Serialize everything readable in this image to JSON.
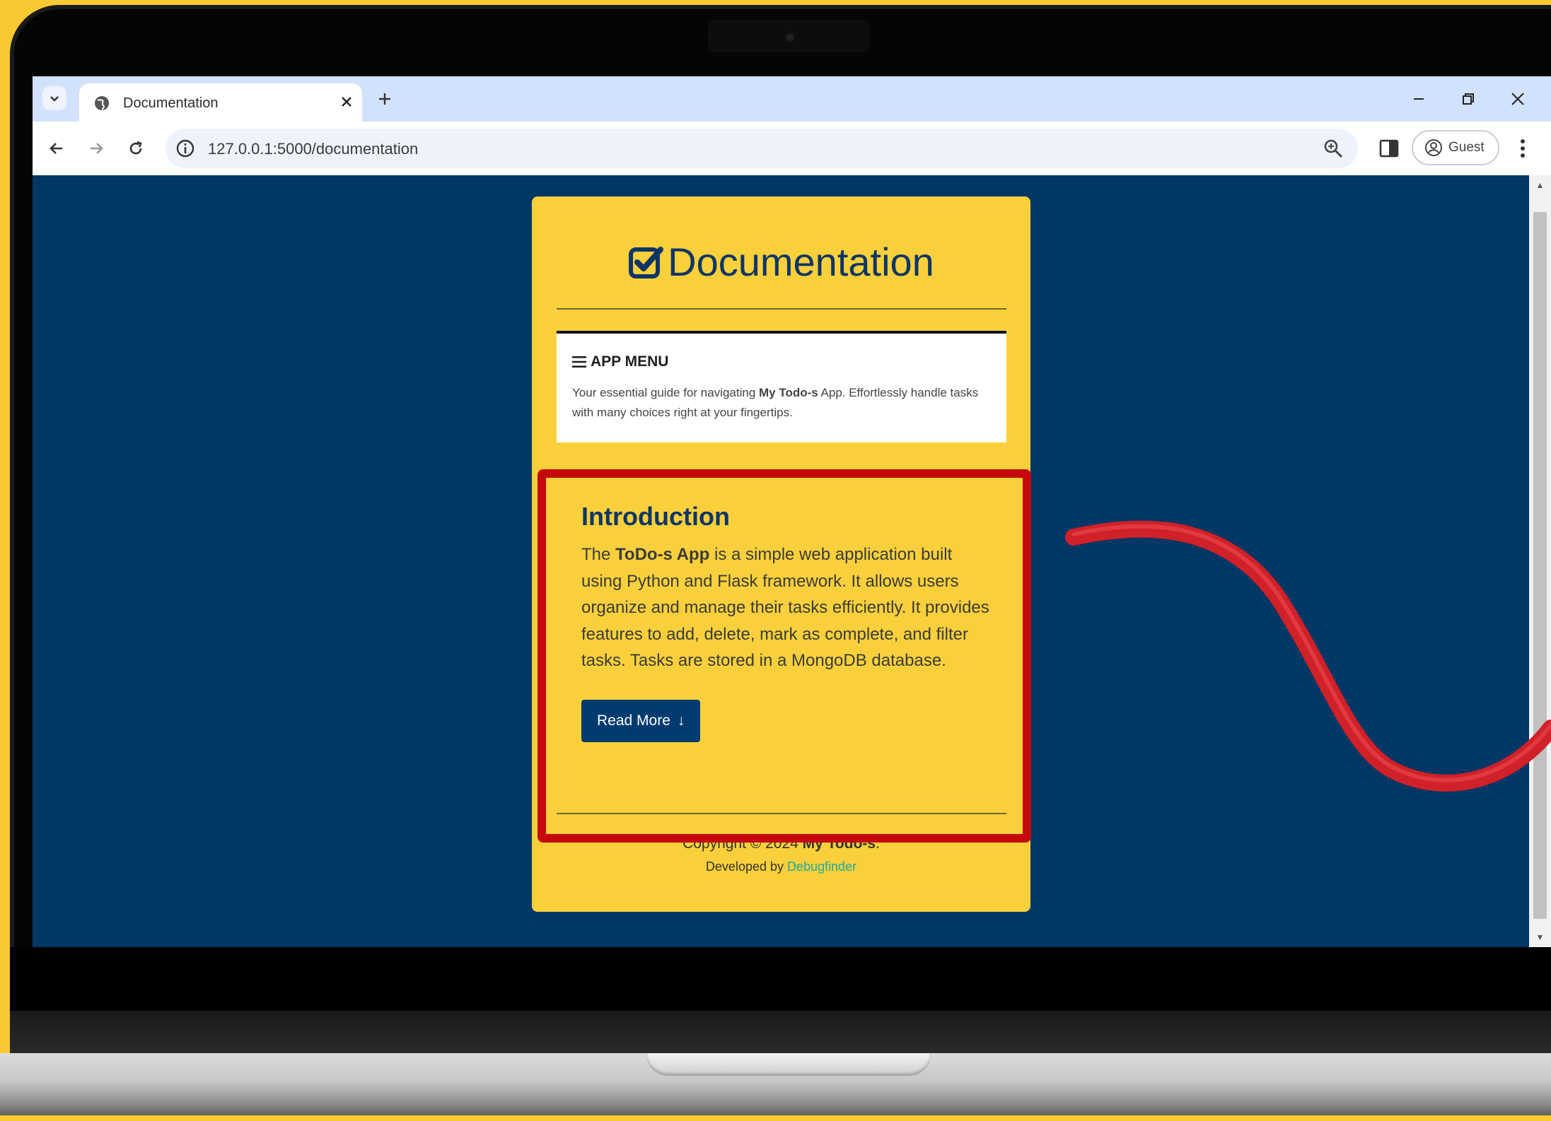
{
  "browser": {
    "tab_title": "Documentation",
    "url": "127.0.0.1:5000/documentation",
    "profile_label": "Guest",
    "icons": [
      "chevron-down-icon",
      "globe-icon",
      "close-icon",
      "plus-icon",
      "minimize-icon",
      "restore-icon",
      "window-close-icon",
      "back-icon",
      "forward-icon",
      "reload-icon",
      "info-icon",
      "zoom-icon",
      "side-panel-icon",
      "profile-icon",
      "kebab-menu-icon"
    ]
  },
  "page": {
    "title": "Documentation",
    "title_icon": "check-square-icon",
    "menu": {
      "heading": "APP MENU",
      "heading_icon": "bars-icon",
      "desc_before": "Your essential guide for navigating ",
      "desc_bold": "My Todo-s",
      "desc_after": " App. Effortlessly handle tasks with many choices right at your fingertips."
    },
    "intro": {
      "title": "Introduction",
      "text_before": "The ",
      "text_bold": "ToDo-s App",
      "text_after": " is a simple web application built using Python and Flask framework. It allows users organize and manage their tasks efficiently. It provides features to add, delete, mark as complete, and filter tasks. Tasks are stored in a MongoDB database.",
      "button_label": "Read More",
      "button_icon": "↓"
    },
    "footer": {
      "copyright_before": "Copyright © 2024 ",
      "copyright_bold": "My Todo-s",
      "copyright_after": ".",
      "developed_before": "Developed by ",
      "developed_link": "Debugfinder"
    }
  },
  "colors": {
    "background_yellow": "#f9c933",
    "page_navy": "#003764",
    "card_yellow": "#f9d03b",
    "button_navy": "#003b6f",
    "highlight_red": "#c5080b",
    "link_teal": "#21a8a0"
  }
}
